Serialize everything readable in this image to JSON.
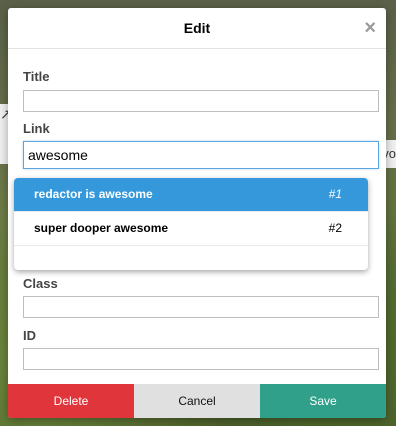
{
  "dialog": {
    "title": "Edit",
    "close_glyph": "×"
  },
  "background": {
    "left_icon": "↗",
    "right_text": "vo"
  },
  "fields": {
    "title": {
      "label": "Title",
      "value": ""
    },
    "link": {
      "label": "Link",
      "value": "awesome"
    },
    "class": {
      "label": "Class",
      "value": ""
    },
    "id": {
      "label": "ID",
      "value": ""
    }
  },
  "suggestions": [
    {
      "text": "redactor is awesome",
      "num": "#1",
      "selected": true
    },
    {
      "text": "super dooper awesome",
      "num": "#2",
      "selected": false
    }
  ],
  "footer": {
    "delete_label": "Delete",
    "cancel_label": "Cancel",
    "save_label": "Save"
  },
  "colors": {
    "accent": "#3498db",
    "delete": "#e0363b",
    "save": "#30a08a",
    "cancel": "#e0e0e0"
  }
}
